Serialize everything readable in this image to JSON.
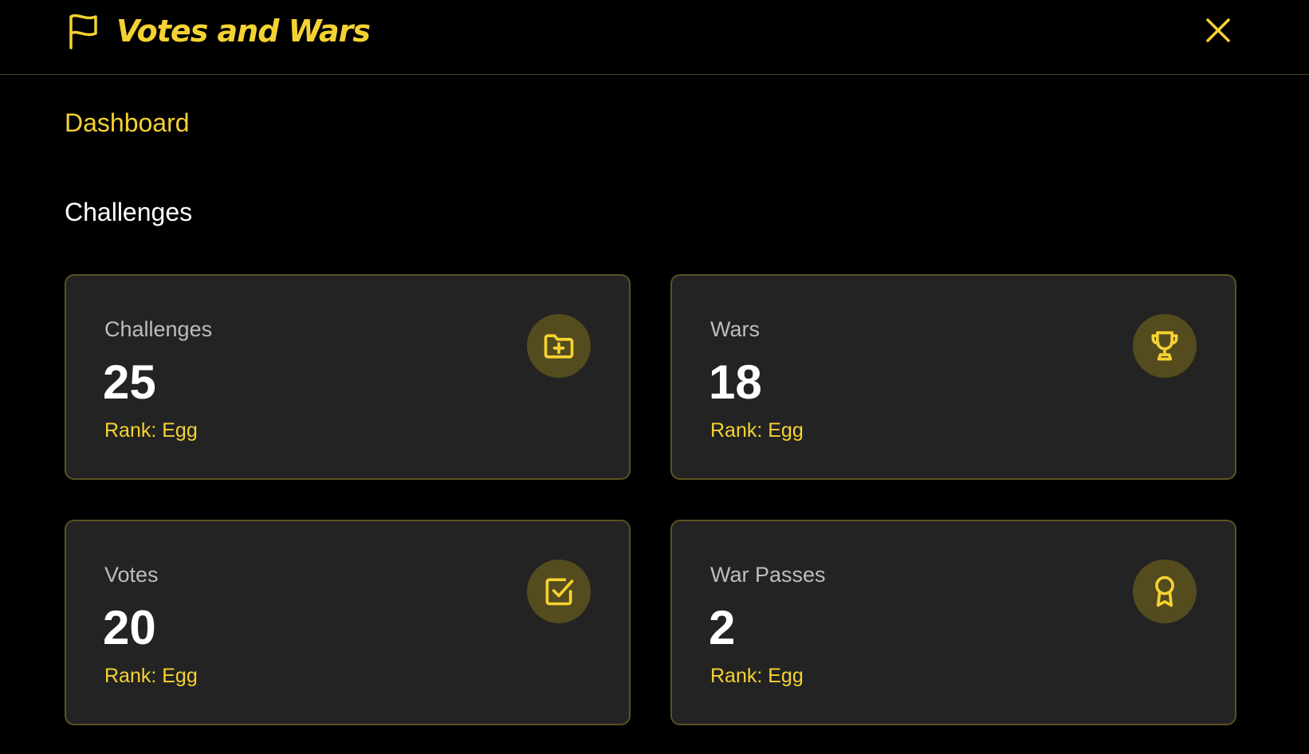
{
  "app": {
    "title": "Votes and Wars"
  },
  "nav": {
    "dashboard_label": "Dashboard"
  },
  "section": {
    "title": "Challenges"
  },
  "cards": [
    {
      "label": "Challenges",
      "value": "25",
      "rank": "Rank: Egg",
      "icon": "folder-plus-icon"
    },
    {
      "label": "Wars",
      "value": "18",
      "rank": "Rank: Egg",
      "icon": "trophy-icon"
    },
    {
      "label": "Votes",
      "value": "20",
      "rank": "Rank: Egg",
      "icon": "check-square-icon"
    },
    {
      "label": "War Passes",
      "value": "2",
      "rank": "Rank: Egg",
      "icon": "award-icon"
    }
  ],
  "colors": {
    "accent": "#f5d232",
    "background": "#000000",
    "card_background": "#232323",
    "card_border": "#5a5220",
    "icon_circle": "#544b1e"
  }
}
